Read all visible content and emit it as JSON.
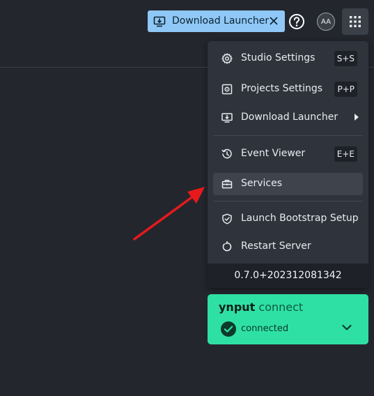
{
  "header": {
    "download_pill_label": "Download Launcher",
    "avatar_initials": "AA"
  },
  "menu": {
    "items": [
      {
        "label": "Studio Settings",
        "shortcut": "S+S",
        "icon": "gear-icon"
      },
      {
        "label": "Projects Settings",
        "shortcut": "P+P",
        "icon": "project-gear-icon"
      },
      {
        "label": "Download Launcher",
        "shortcut": "",
        "icon": "download-monitor-icon"
      },
      {
        "label": "Event Viewer",
        "shortcut": "E+E",
        "icon": "history-icon"
      },
      {
        "label": "Services",
        "shortcut": "",
        "icon": "toolbox-icon"
      },
      {
        "label": "Launch Bootstrap Setup",
        "shortcut": "",
        "icon": "shield-check-icon"
      },
      {
        "label": "Restart Server",
        "shortcut": "",
        "icon": "restart-icon"
      }
    ],
    "version": "0.7.0+202312081342"
  },
  "connect": {
    "brand_bold": "ynput",
    "brand_thin": "connect",
    "status": "connected"
  },
  "colors": {
    "background": "#23262d",
    "menu": "#2f333b",
    "pill": "#8fc8f6",
    "connect": "#2fe0a5",
    "arrow": "#e8191c"
  }
}
